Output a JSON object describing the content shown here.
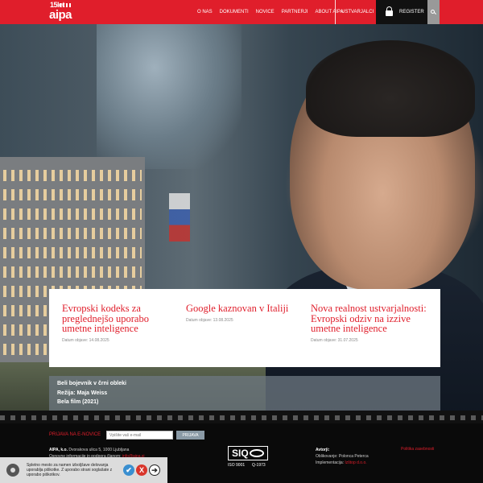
{
  "header": {
    "logo": {
      "number": "15let",
      "word": "aipa"
    },
    "nav": [
      "O NAS",
      "DOKUMENTI",
      "NOVICE",
      "PARTNERJI",
      "ABOUT AIPA"
    ],
    "ustvarjalci": "USTVARJALCI",
    "register": "REGISTER",
    "brand_color": "#e01e2b"
  },
  "news": [
    {
      "title": "Evropski kodeks za preglednejšo uporabo umetne inteligence",
      "date": "Datum objave: 14.08.2025"
    },
    {
      "title": "Google kaznovan v Italiji",
      "date": "Datum objave: 13.08.2025"
    },
    {
      "title": "Nova realnost ustvarjalnosti: Evropski odziv na izzive umetne inteligence",
      "date": "Datum objave: 31.07.2025"
    }
  ],
  "film": {
    "title": "Beli bojevnik v črni obleki",
    "director": "Režija: Maja Weiss",
    "film_year": "Bela film (2021)"
  },
  "footer": {
    "newsletter_label": "PRIJAVA NA E-NOVICE",
    "newsletter_placeholder": "Vpišite vaš e-mail",
    "newsletter_button": "PRIJAVA",
    "company": "AIPA, k.o.",
    "address": "Dvorakova ulica 5, 1000 Ljubljana",
    "support_text": "Osnovne informacije in podpora članom:",
    "support_email": "info@aipa.si",
    "si_logo": "SIQ",
    "iso1": "ISO 9001",
    "iso2": "Q-1973",
    "authors_label": "Avtorji:",
    "design": "Oblikovanje: Polonca Peterca",
    "impl_label": "Implementacija:",
    "impl_name": "Izštop d.o.o.",
    "privacy": "Politika zasebnosti"
  },
  "cookie": {
    "text": "Spletno mesto za namen izboljšave delovanja uporablja piškotke. Z uporabo strani soglašate z uporabo piškotkov.",
    "accept": "✔",
    "decline": "X",
    "more": "➔"
  }
}
